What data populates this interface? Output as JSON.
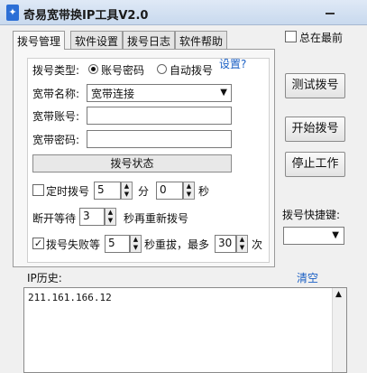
{
  "window": {
    "title": "奇易宽带换IP工具V2.0"
  },
  "tabs": [
    "拨号管理",
    "软件设置",
    "拨号日志",
    "软件帮助"
  ],
  "always_on_top": {
    "label": "总在最前",
    "checked": false
  },
  "dial_type": {
    "label": "拨号类型:",
    "options": [
      "账号密码",
      "自动拨号"
    ],
    "selected": "账号密码",
    "help_link": "设置?"
  },
  "broadband_name": {
    "label": "宽带名称:",
    "value": "宽带连接"
  },
  "broadband_account": {
    "label": "宽带账号:",
    "value": ""
  },
  "broadband_password": {
    "label": "宽带密码:",
    "value": ""
  },
  "dial_status_label": "拨号状态",
  "timed_dial": {
    "label": "定时拨号",
    "checked": false,
    "minutes": "5",
    "minutes_unit": "分",
    "seconds": "0",
    "seconds_unit": "秒"
  },
  "reconnect": {
    "prefix": "断开等待",
    "value": "3",
    "suffix": "秒再重新拨号"
  },
  "retry": {
    "label": "拨号失败等",
    "checked": true,
    "seconds": "5",
    "middle": "秒重拔，最多",
    "times": "30",
    "suffix": "次"
  },
  "buttons": {
    "test": "测试拨号",
    "start": "开始拨号",
    "stop": "停止工作"
  },
  "shortcut": {
    "label": "拨号快捷键:",
    "value": ""
  },
  "history": {
    "label": "IP历史:",
    "clear": "清空",
    "entries": [
      "211.161.166.12"
    ]
  }
}
